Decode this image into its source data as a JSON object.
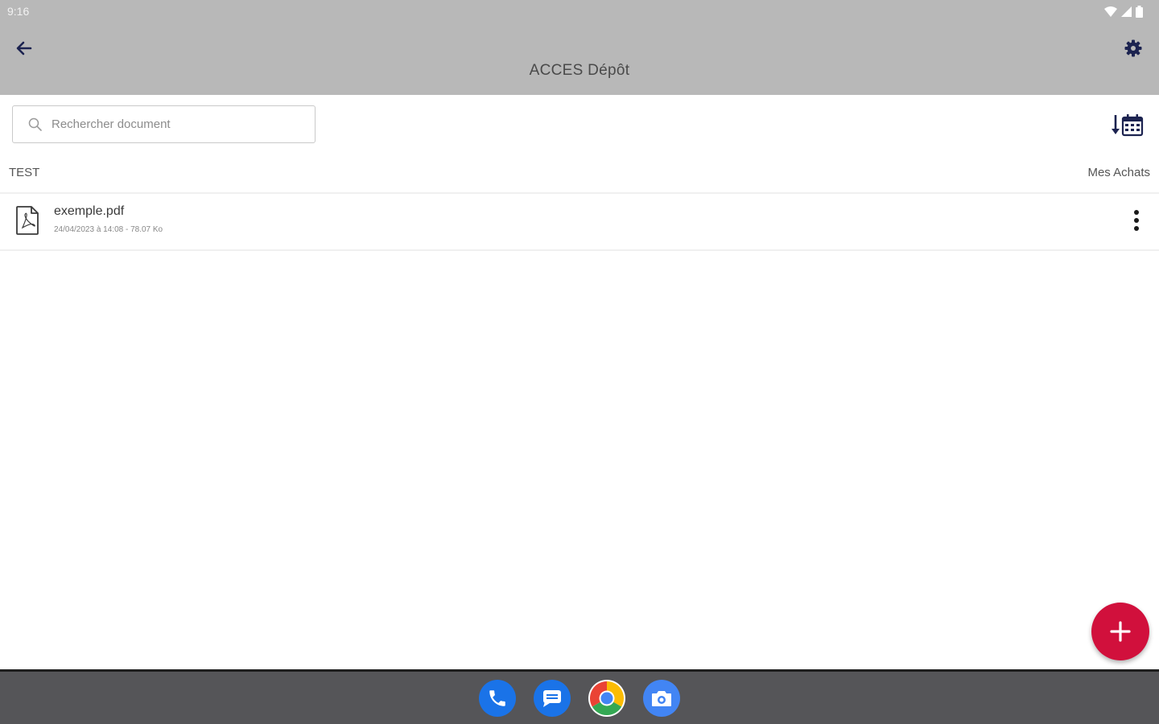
{
  "status_bar": {
    "time": "9:16"
  },
  "app_bar": {
    "title": "ACCES Dépôt",
    "back_icon": "arrow-left-icon",
    "settings_icon": "gear-icon"
  },
  "search": {
    "placeholder": "Rechercher document",
    "value": ""
  },
  "toolbar": {
    "sort_icon": "sort-by-date-icon"
  },
  "section": {
    "left_label": "TEST",
    "right_label": "Mes Achats"
  },
  "documents": [
    {
      "name": "exemple.pdf",
      "meta": "24/04/2023 à 14:08 - 78.07 Ko",
      "icon": "pdf-file-icon"
    }
  ],
  "fab": {
    "icon": "plus-icon"
  },
  "dock": {
    "apps": [
      {
        "name": "Phone",
        "icon": "phone-icon"
      },
      {
        "name": "Messages",
        "icon": "messages-icon"
      },
      {
        "name": "Chrome",
        "icon": "chrome-icon"
      },
      {
        "name": "Camera",
        "icon": "camera-icon"
      }
    ]
  },
  "colors": {
    "app_bar_bg": "#b8b8b8",
    "accent": "#d1103c",
    "icon_navy": "#1c2350",
    "nav_bar_bg": "#555558"
  }
}
